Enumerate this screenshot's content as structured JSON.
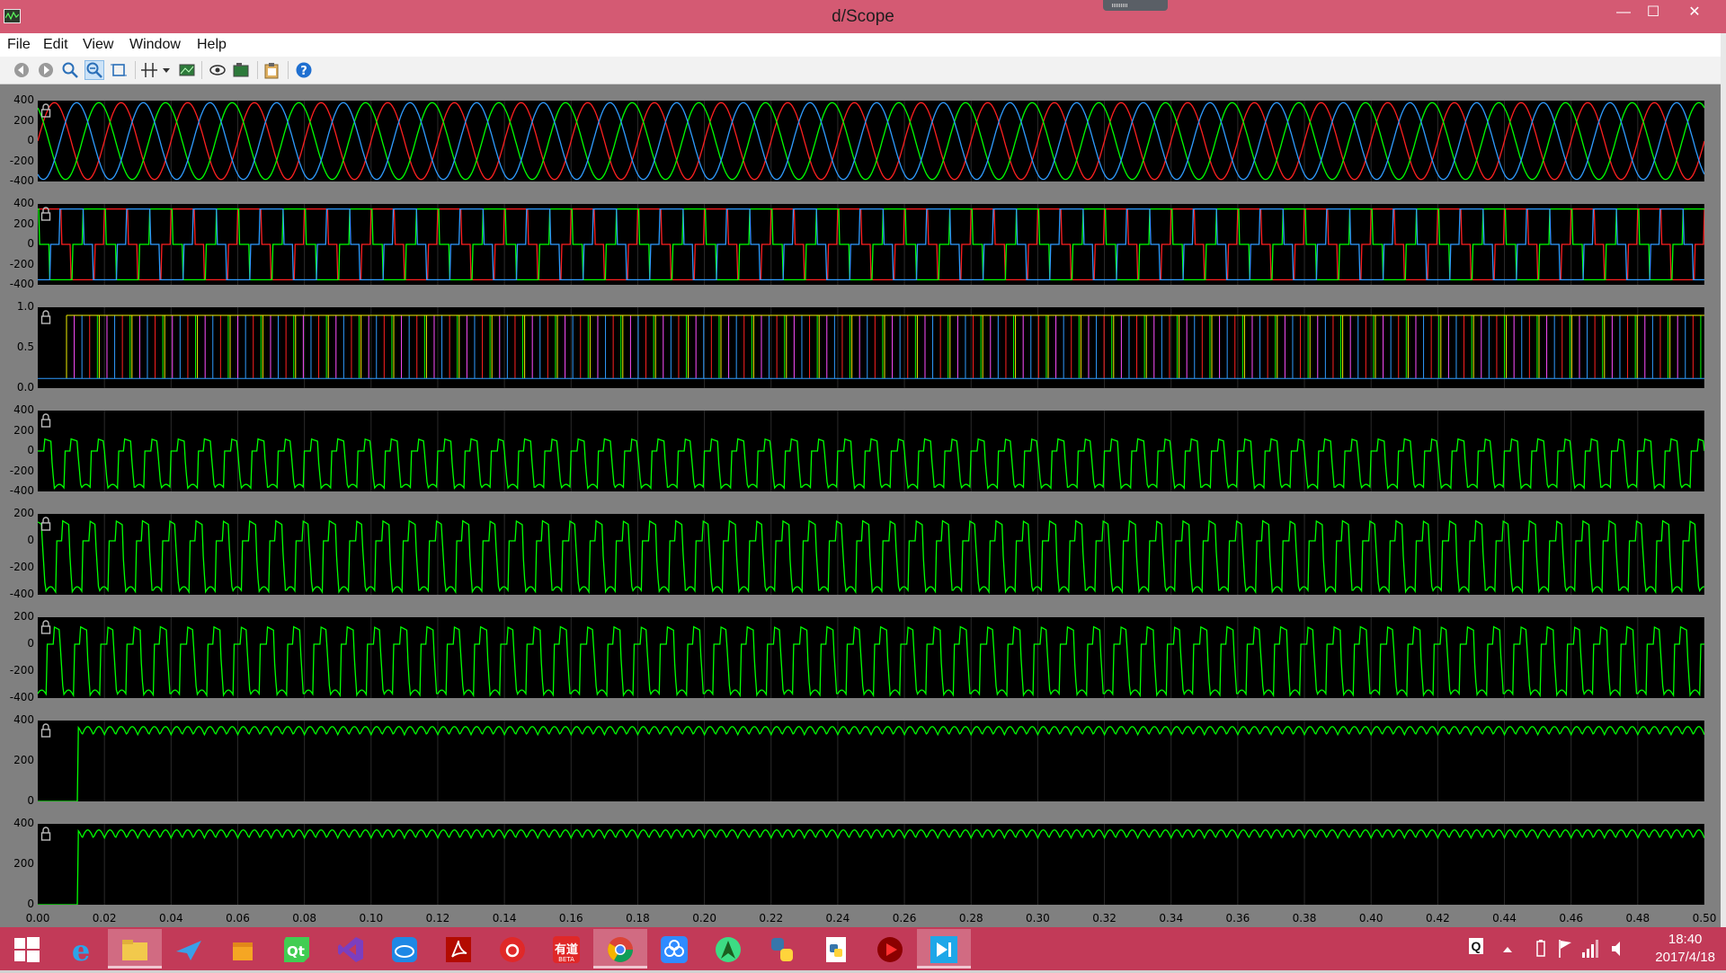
{
  "window": {
    "title": "d/Scope"
  },
  "window_controls": {
    "minimize": "—",
    "maximize": "☐",
    "close": "✕"
  },
  "menu": {
    "file": "File",
    "edit": "Edit",
    "view": "View",
    "window": "Window",
    "help": "Help"
  },
  "toolbar": {
    "buttons": [
      "back-icon",
      "forward-icon",
      "zoom-in-icon",
      "zoom-out-icon",
      "zoom-box-icon",
      "cursor-icon",
      "dropdown-icon",
      "image-icon",
      "eye-icon",
      "camera-icon",
      "clipboard-icon",
      "help-icon"
    ]
  },
  "colors": {
    "red": "#ff2020",
    "green": "#00ff00",
    "blue": "#2f9cff",
    "yellow": "#f0f000",
    "magenta": "#ff4dff",
    "background": "#000000"
  },
  "chart_data": [
    {
      "type": "line",
      "y_ticks": [
        "400",
        "200",
        "0",
        "-200",
        "-400"
      ],
      "ylim": [
        -400,
        400
      ],
      "xlim": [
        0,
        0.5
      ]
    },
    {
      "type": "line",
      "y_ticks": [
        "400",
        "200",
        "0",
        "-200",
        "-400"
      ],
      "ylim": [
        -400,
        400
      ],
      "xlim": [
        0,
        0.5
      ]
    },
    {
      "type": "line",
      "y_ticks": [
        "1.0",
        "0.5",
        "0.0"
      ],
      "ylim": [
        0,
        1
      ],
      "xlim": [
        0,
        0.5
      ]
    },
    {
      "type": "line",
      "y_ticks": [
        "400",
        "200",
        "0",
        "-200",
        "-400"
      ],
      "ylim": [
        -400,
        400
      ],
      "xlim": [
        0,
        0.5
      ]
    },
    {
      "type": "line",
      "y_ticks": [
        "200",
        "0",
        "-200",
        "-400"
      ],
      "ylim": [
        -400,
        200
      ],
      "xlim": [
        0,
        0.5
      ]
    },
    {
      "type": "line",
      "y_ticks": [
        "200",
        "0",
        "-200",
        "-400"
      ],
      "ylim": [
        -400,
        200
      ],
      "xlim": [
        0,
        0.5
      ]
    },
    {
      "type": "line",
      "y_ticks": [
        "400",
        "200",
        "0"
      ],
      "ylim": [
        0,
        400
      ],
      "xlim": [
        0,
        0.5
      ]
    },
    {
      "type": "line",
      "y_ticks": [
        "400",
        "200",
        "0"
      ],
      "ylim": [
        0,
        400
      ],
      "xlim": [
        0,
        0.5
      ]
    }
  ],
  "x_axis": {
    "ticks": [
      "0.00",
      "0.02",
      "0.04",
      "0.06",
      "0.08",
      "0.10",
      "0.12",
      "0.14",
      "0.16",
      "0.18",
      "0.20",
      "0.22",
      "0.24",
      "0.26",
      "0.28",
      "0.30",
      "0.32",
      "0.34",
      "0.36",
      "0.38",
      "0.40",
      "0.42",
      "0.44",
      "0.46",
      "0.48",
      "0.50"
    ]
  },
  "taskbar": {
    "apps": [
      "windows-start-icon",
      "internet-explorer-icon",
      "file-explorer-icon",
      "bird-app-icon",
      "box-app-icon",
      "qt-icon",
      "visual-studio-icon",
      "cloud-app-icon",
      "acrobat-icon",
      "netease-music-icon",
      "youdao-icon",
      "chrome-icon",
      "baidu-cloud-icon",
      "android-studio-icon",
      "python-icon",
      "python-file-icon",
      "media-player-icon",
      "dscope-icon"
    ],
    "youdao_label": "有道",
    "youdao_badge": "BETA",
    "tray_q": "Q",
    "clock_time": "18:40",
    "clock_date": "2017/4/18"
  }
}
